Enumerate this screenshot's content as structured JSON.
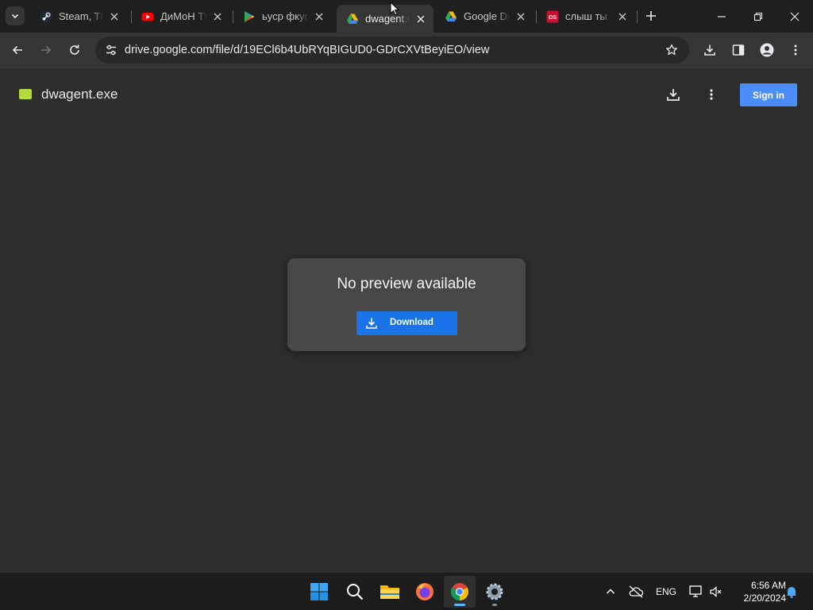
{
  "browser": {
    "tabs": [
      {
        "title": "Steam, The Ultimate Online Game Platform",
        "favicon": "steam-icon"
      },
      {
        "title": "ДиМоН ТВ",
        "favicon": "youtube-icon"
      },
      {
        "title": "ьуср фкуг",
        "favicon": "google-play-icon"
      },
      {
        "title": "dwagent.exe",
        "favicon": "google-drive-icon",
        "active": true
      },
      {
        "title": "Google Drive",
        "favicon": "google-drive-icon"
      },
      {
        "title": "слыш ты",
        "favicon": "os-icon"
      }
    ],
    "url": "drive.google.com/file/d/19ECl6b4UbRYqBIGUD0-GDrCXVtBeyiEO/view"
  },
  "drive": {
    "file_name": "dwagent.exe",
    "sign_in_label": "Sign in",
    "preview_message": "No preview available",
    "download_label": "Download"
  },
  "taskbar": {
    "language": "ENG",
    "time": "6:56 AM",
    "date": "2/20/2024"
  },
  "colors": {
    "accent_blue": "#1a73e8",
    "signin_blue": "#4b8df8",
    "file_icon": "#b8d93d",
    "page_bg": "#2d2d2d"
  }
}
